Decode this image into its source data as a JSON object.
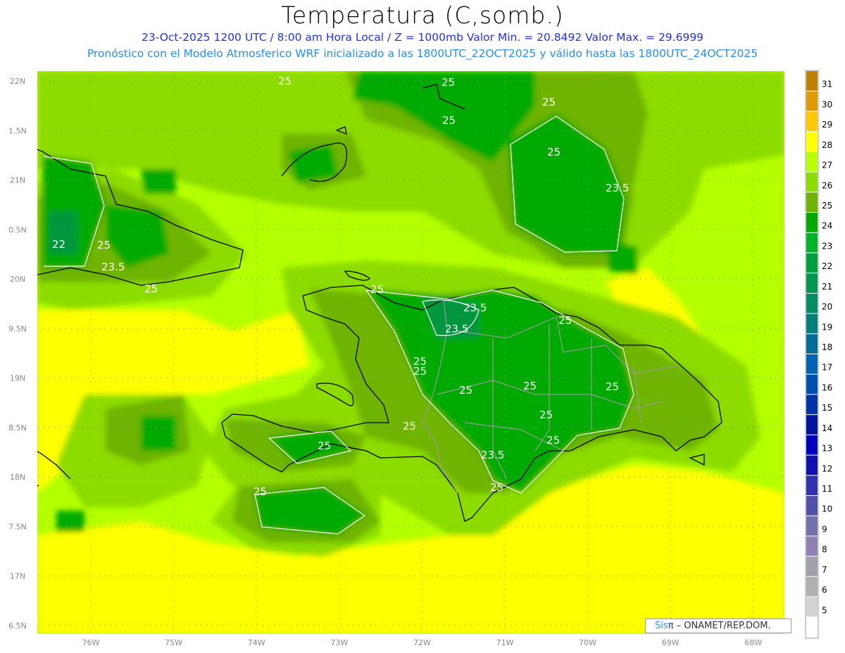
{
  "header": {
    "title": "Temperatura (C,somb.)",
    "subtitle1": "23-Oct-2025  1200 UTC / 8:00 am Hora Local / Z = 1000mb   Valor Min. = 20.8492  Valor Max. = 29.6999",
    "subtitle2": "Pronóstico con el Modelo Atmosferico WRF inicializado a las 1800UTC_22OCT2025 y válido hasta las  1800UTC_24OCT2025"
  },
  "axes": {
    "lon_labels": [
      "76W",
      "75W",
      "74W",
      "73W",
      "72W",
      "71W",
      "70W",
      "69W",
      "68W"
    ],
    "lon_values": [
      -76,
      -75,
      -74,
      -73,
      -72,
      -71,
      -70,
      -69,
      -68
    ],
    "lat_labels": [
      "22N",
      "1.5N",
      "21N",
      "0.5N",
      "20N",
      "9.5N",
      "19N",
      "8.5N",
      "18N",
      "7.5N",
      "17N",
      "6.5N"
    ],
    "lat_values": [
      22,
      21.5,
      21,
      20.5,
      20,
      19.5,
      19,
      18.5,
      18,
      17.5,
      17,
      16.5
    ]
  },
  "contour_labels": [
    "25",
    "25",
    "25",
    "25",
    "23.5",
    "22",
    "25",
    "23.5",
    "25",
    "25",
    "23.5",
    "23.5",
    "25",
    "25",
    "25",
    "25",
    "25",
    "25",
    "25",
    "25",
    "25",
    "23.5",
    "25",
    "25",
    "25",
    "25"
  ],
  "colorbar": {
    "labels": [
      "31",
      "30",
      "29",
      "28",
      "27",
      "26",
      "25",
      "24",
      "23",
      "22",
      "21",
      "20",
      "19",
      "18",
      "17",
      "16",
      "15",
      "14",
      "13",
      "12",
      "11",
      "10",
      "9",
      "8",
      "7",
      "6",
      "5"
    ],
    "colors": [
      "#c08000",
      "#e09a00",
      "#ffc800",
      "#ffff00",
      "#b4ff00",
      "#8cdc00",
      "#6eb400",
      "#00aa00",
      "#00b428",
      "#00a03c",
      "#009650",
      "#008c64",
      "#008078",
      "#006e96",
      "#0064b4",
      "#0050b4",
      "#0032aa",
      "#0014a0",
      "#0000c0",
      "#1010b0",
      "#3232b0",
      "#5050aa",
      "#7070aa",
      "#9080b4",
      "#a0a0aa",
      "#b0b0b0",
      "#d2d2d2",
      "#ffffff"
    ]
  },
  "credit": {
    "sis": "Sis",
    "pi": "π",
    "text": " – ONAMET/REP.DOM."
  }
}
